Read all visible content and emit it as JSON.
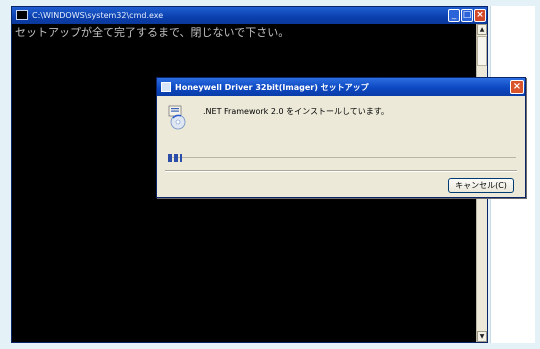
{
  "console": {
    "title": "C:\\WINDOWS\\system32\\cmd.exe",
    "message": "セットアップが全て完了するまで、閉じないで下さい。",
    "controls": {
      "minimize": "_",
      "maximize": "□",
      "close": "×"
    }
  },
  "dialog": {
    "title": "Honeywell Driver 32bit(Imager) セットアップ",
    "message": ".NET Framework 2.0 をインストールしています。",
    "progress_fraction": 0.04,
    "cancel_label": "キャンセル(C)",
    "close_glyph": "×"
  },
  "icons": {
    "console_window": "console-window-icon",
    "setup": "setup-app-icon",
    "installer": "installer-cd-icon"
  }
}
